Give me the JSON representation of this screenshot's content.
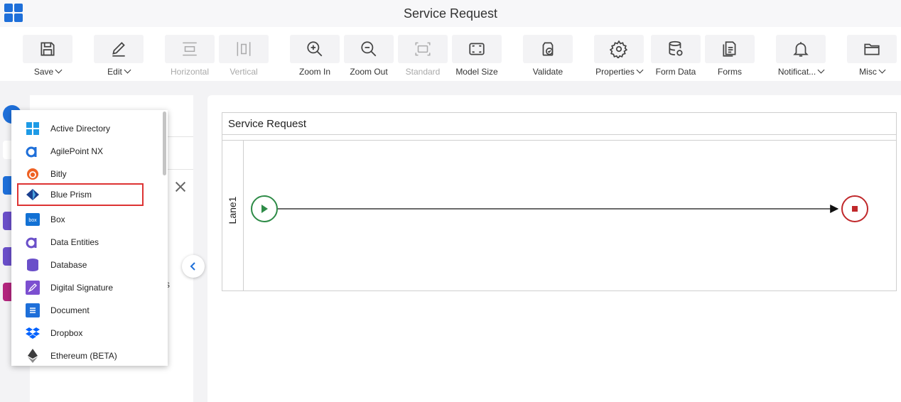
{
  "header": {
    "title": "Service Request"
  },
  "toolbar": {
    "save": "Save",
    "edit": "Edit",
    "horizontal": "Horizontal",
    "vertical": "Vertical",
    "zoom_in": "Zoom In",
    "zoom_out": "Zoom Out",
    "standard": "Standard",
    "model_size": "Model Size",
    "validate": "Validate",
    "properties": "Properties",
    "form_data": "Form Data",
    "forms": "Forms",
    "notifications": "Notificat...",
    "misc": "Misc"
  },
  "menu": {
    "items": [
      {
        "label": "Active Directory",
        "icon": "windows-icon"
      },
      {
        "label": "AgilePoint NX",
        "icon": "agilepoint-icon"
      },
      {
        "label": "Bitly",
        "icon": "bitly-icon"
      },
      {
        "label": "Blue Prism",
        "icon": "blue-prism-icon",
        "highlighted": true
      },
      {
        "label": "Box",
        "icon": "box-icon"
      },
      {
        "label": "Data Entities",
        "icon": "data-entities-icon"
      },
      {
        "label": "Database",
        "icon": "database-icon"
      },
      {
        "label": "Digital Signature",
        "icon": "digital-signature-icon"
      },
      {
        "label": "Document",
        "icon": "document-icon"
      },
      {
        "label": "Dropbox",
        "icon": "dropbox-icon"
      },
      {
        "label": "Ethereum (BETA)",
        "icon": "ethereum-icon"
      }
    ]
  },
  "sidepanel": {
    "peek_text": "s"
  },
  "canvas": {
    "pool_title": "Service Request",
    "lane_label": "Lane1"
  },
  "colors": {
    "accent": "#1e6fd9",
    "start_event": "#2e8b47",
    "end_event": "#c0282b",
    "highlight_border": "#dd3333"
  }
}
